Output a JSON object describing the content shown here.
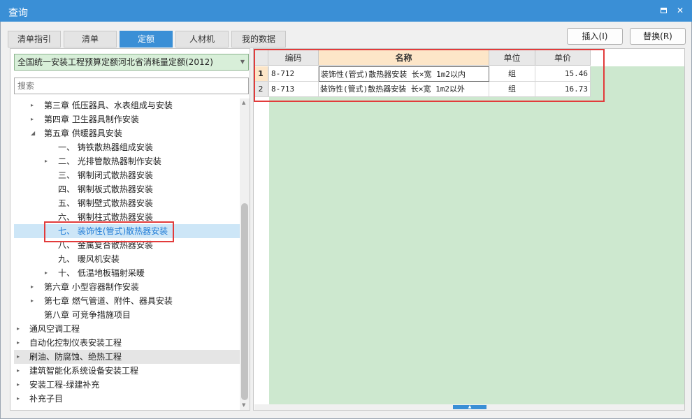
{
  "window": {
    "title": "查询",
    "maximize_icon": "maximize-icon",
    "close_icon": "close-icon",
    "close_glyph": "✕"
  },
  "tabs": [
    {
      "label": "清单指引",
      "active": false
    },
    {
      "label": "清单",
      "active": false
    },
    {
      "label": "定额",
      "active": true
    },
    {
      "label": "人材机",
      "active": false
    },
    {
      "label": "我的数据",
      "active": false
    }
  ],
  "actions": {
    "insert_label": "插入(I)",
    "replace_label": "替换(R)"
  },
  "left": {
    "quota_library": "全国统一安装工程预算定额河北省消耗量定额(2012)",
    "search_placeholder": "搜索",
    "tree": [
      {
        "label": "第三章 低压器具、水表组成与安装",
        "level": 1,
        "expander": "▸"
      },
      {
        "label": "第四章 卫生器具制作安装",
        "level": 1,
        "expander": "▸"
      },
      {
        "label": "第五章 供暖器具安装",
        "level": 1,
        "expander": "◢"
      },
      {
        "label": "一、 铸铁散热器组成安装",
        "level": 2,
        "expander": ""
      },
      {
        "label": "二、 光排管散热器制作安装",
        "level": 2,
        "expander": "▸"
      },
      {
        "label": "三、 钢制闭式散热器安装",
        "level": 2,
        "expander": ""
      },
      {
        "label": "四、 钢制板式散热器安装",
        "level": 2,
        "expander": ""
      },
      {
        "label": "五、 钢制壁式散热器安装",
        "level": 2,
        "expander": ""
      },
      {
        "label": "六、 钢制柱式散热器安装",
        "level": 2,
        "expander": ""
      },
      {
        "label": "七、 装饰性(管式)散热器安装",
        "level": 2,
        "expander": "",
        "selected": true
      },
      {
        "label": "八、 金属复合散热器安装",
        "level": 2,
        "expander": ""
      },
      {
        "label": "九、 暖风机安装",
        "level": 2,
        "expander": ""
      },
      {
        "label": "十、 低温地板辐射采暖",
        "level": 2,
        "expander": "▸"
      },
      {
        "label": "第六章 小型容器制作安装",
        "level": 1,
        "expander": "▸"
      },
      {
        "label": "第七章 燃气管道、附件、器具安装",
        "level": 1,
        "expander": "▸"
      },
      {
        "label": "第八章 可竞争措施项目",
        "level": 1,
        "expander": ""
      },
      {
        "label": "通风空调工程",
        "level": 0,
        "expander": "▸"
      },
      {
        "label": "自动化控制仪表安装工程",
        "level": 0,
        "expander": "▸"
      },
      {
        "label": "刷油、防腐蚀、绝热工程",
        "level": 0,
        "expander": "▸",
        "hover": true
      },
      {
        "label": "建筑智能化系统设备安装工程",
        "level": 0,
        "expander": "▸"
      },
      {
        "label": "安装工程-绿建补充",
        "level": 0,
        "expander": "▸"
      },
      {
        "label": "补充子目",
        "level": 0,
        "expander": "▸"
      }
    ]
  },
  "grid": {
    "headers": {
      "code": "编码",
      "name": "名称",
      "unit": "单位",
      "price": "单价"
    },
    "rows": [
      {
        "num": "1",
        "code": "8-712",
        "name": "装饰性(管式)散热器安装 长×宽 1m2以内",
        "unit": "组",
        "price": "15.46"
      },
      {
        "num": "2",
        "code": "8-713",
        "name": "装饰性(管式)散热器安装 长×宽 1m2以外",
        "unit": "组",
        "price": "16.73"
      }
    ]
  },
  "colors": {
    "accent": "#3a8fd6",
    "highlight_red": "#e23b3b",
    "grid_bg_green": "#cde8cf",
    "selected_row": "#cde6f7"
  }
}
